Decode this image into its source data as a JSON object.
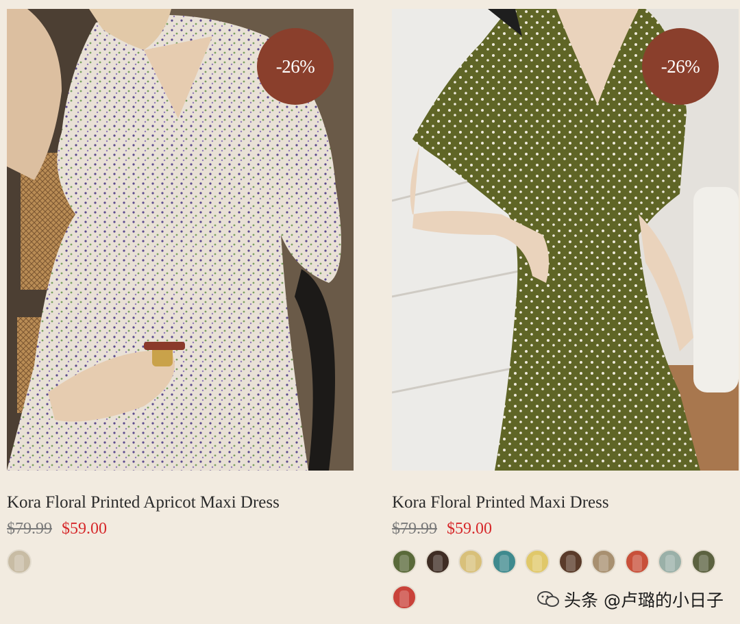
{
  "products": [
    {
      "title": "Kora Floral Printed Apricot Maxi Dress",
      "old_price": "$79.99",
      "new_price": "$59.00",
      "badge": "-26%",
      "badge_color": "#8a3f2c",
      "swatches": [
        "#c8bca4"
      ]
    },
    {
      "title": "Kora Floral Printed Maxi Dress",
      "old_price": "$79.99",
      "new_price": "$59.00",
      "badge": "-26%",
      "badge_color": "#8a3f2c",
      "swatches": [
        "#5a6a3a",
        "#3f2d24",
        "#d8c07a",
        "#3f8a8e",
        "#e0c86a",
        "#5a3b2a",
        "#a89070",
        "#c8503a",
        "#9ab0a8",
        "#5c6240",
        "#c9423a"
      ]
    }
  ],
  "watermark": "头条 @卢璐的小日子"
}
